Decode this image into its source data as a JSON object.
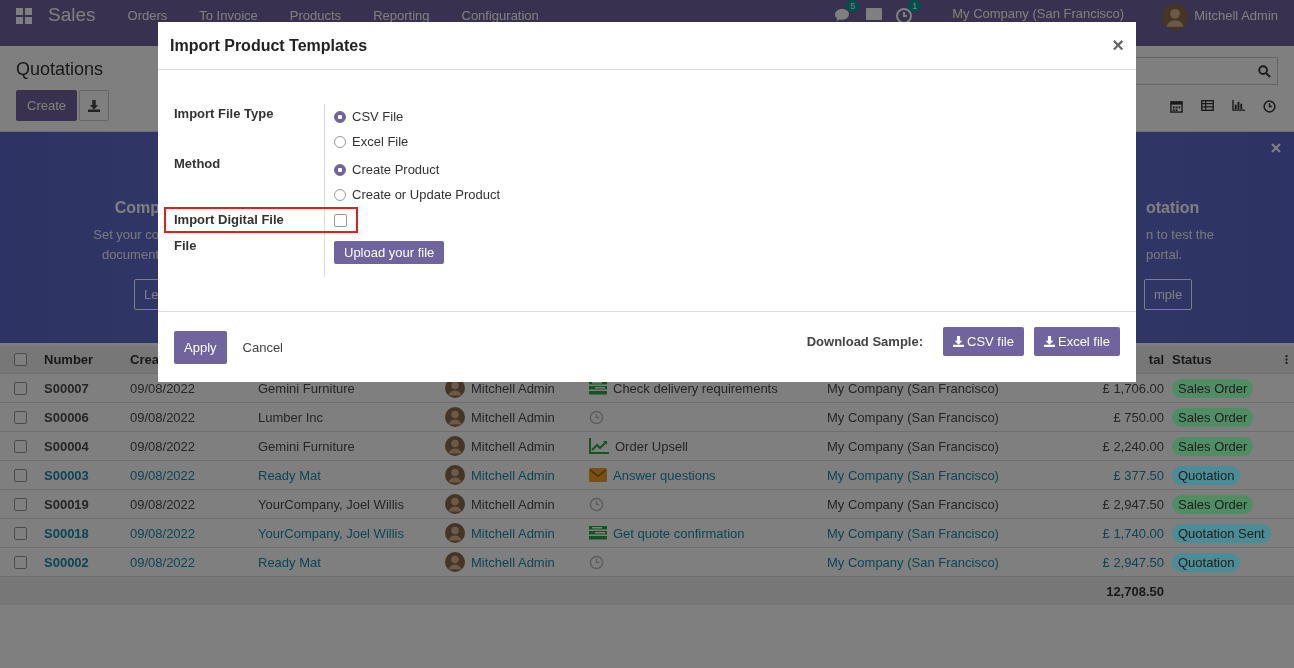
{
  "navbar": {
    "app_name": "Sales",
    "menu": [
      "Orders",
      "To Invoice",
      "Products",
      "Reporting",
      "Configuration"
    ],
    "messages_badge": "5",
    "activities_badge": "1",
    "company": "My Company (San Francisco)",
    "user": "Mitchell Admin"
  },
  "control_panel": {
    "title": "Quotations",
    "create_button": "Create"
  },
  "banner": {
    "left_title": "Comp",
    "left_lines": [
      "Set your co",
      "document"
    ],
    "left_button": "Le",
    "right_title": "otation",
    "right_lines": [
      "n to test the",
      "portal."
    ],
    "right_button": "mple"
  },
  "table": {
    "all_checked": false,
    "columns": [
      {
        "label": "Number"
      },
      {
        "label": "Crea"
      },
      {
        "label": "tal"
      },
      {
        "label": "Status"
      }
    ],
    "rows": [
      {
        "number": "S00007",
        "date": "09/08/2022",
        "customer": "Gemini Furniture",
        "salesperson": "Mitchell Admin",
        "activity": {
          "kind": "tasks",
          "label": "Check delivery requirements"
        },
        "company": "My Company (San Francisco)",
        "total": "£ 1,706.00",
        "status": {
          "label": "Sales Order",
          "color": "#508c64"
        },
        "highlighted": false,
        "checked": false
      },
      {
        "number": "S00006",
        "date": "09/08/2022",
        "customer": "Lumber Inc",
        "salesperson": "Mitchell Admin",
        "activity": {
          "kind": "clock"
        },
        "company": "My Company (San Francisco)",
        "total": "£ 750.00",
        "status": {
          "label": "Sales Order",
          "color": "#508c64"
        },
        "highlighted": false,
        "checked": false
      },
      {
        "number": "S00004",
        "date": "09/08/2022",
        "customer": "Gemini Furniture",
        "salesperson": "Mitchell Admin",
        "activity": {
          "kind": "chart",
          "label": "Order Upsell"
        },
        "company": "My Company (San Francisco)",
        "total": "£ 2,240.00",
        "status": {
          "label": "Sales Order",
          "color": "#508c64"
        },
        "highlighted": false,
        "checked": false
      },
      {
        "number": "S00003",
        "date": "09/08/2022",
        "customer": "Ready Mat",
        "salesperson": "Mitchell Admin",
        "activity": {
          "kind": "mail",
          "label": "Answer questions"
        },
        "company": "My Company (San Francisco)",
        "total": "£ 377.50",
        "status": {
          "label": "Quotation",
          "color": "#4b8c96"
        },
        "highlighted": true,
        "checked": false
      },
      {
        "number": "S00019",
        "date": "09/08/2022",
        "customer": "YourCompany, Joel Willis",
        "salesperson": "Mitchell Admin",
        "activity": {
          "kind": "clock"
        },
        "company": "My Company (San Francisco)",
        "total": "£ 2,947.50",
        "status": {
          "label": "Sales Order",
          "color": "#508c64"
        },
        "highlighted": false,
        "checked": false
      },
      {
        "number": "S00018",
        "date": "09/08/2022",
        "customer": "YourCompany, Joel Willis",
        "salesperson": "Mitchell Admin",
        "activity": {
          "kind": "tasks",
          "label": "Get quote confirmation"
        },
        "company": "My Company (San Francisco)",
        "total": "£ 1,740.00",
        "status": {
          "label": "Quotation Sent",
          "color": "#4b8c96"
        },
        "highlighted": true,
        "checked": false
      },
      {
        "number": "S00002",
        "date": "09/08/2022",
        "customer": "Ready Mat",
        "salesperson": "Mitchell Admin",
        "activity": {
          "kind": "clock"
        },
        "company": "My Company (San Francisco)",
        "total": "£ 2,947.50",
        "status": {
          "label": "Quotation",
          "color": "#4b8c96"
        },
        "highlighted": true,
        "checked": false
      }
    ],
    "grand_total": "12,708.50"
  },
  "dialog": {
    "title": "Import Product Templates",
    "close": "×",
    "fields": [
      {
        "label": "Import File Type",
        "kind": "radio",
        "options": [
          {
            "label": "CSV File",
            "selected": true
          },
          {
            "label": "Excel File",
            "selected": false
          }
        ]
      },
      {
        "label": "Method",
        "kind": "radio",
        "options": [
          {
            "label": "Create Product",
            "selected": true
          },
          {
            "label": "Create or Update Product",
            "selected": false
          }
        ]
      },
      {
        "label": "Import Digital File",
        "kind": "checkbox",
        "checked": false,
        "highlighted": true
      },
      {
        "label": "File",
        "kind": "upload",
        "button": "Upload your file"
      }
    ],
    "apply": "Apply",
    "cancel": "Cancel",
    "download_label": "Download Sample:",
    "download_buttons": [
      "CSV file",
      "Excel file"
    ]
  }
}
